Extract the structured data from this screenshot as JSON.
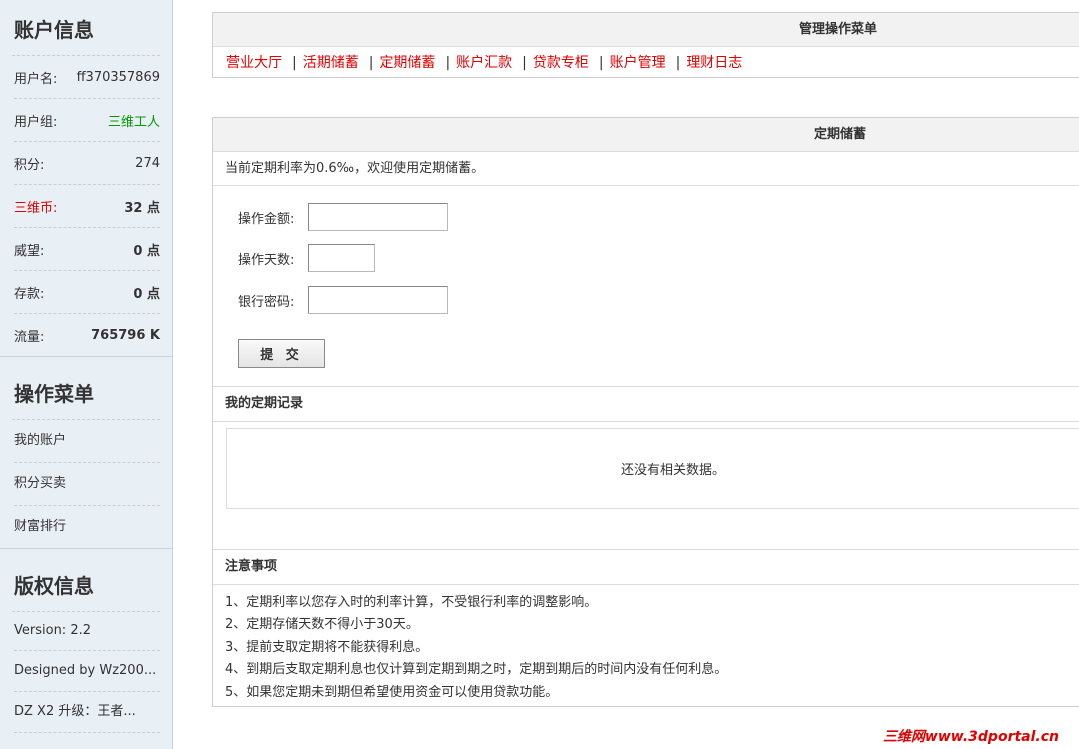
{
  "sidebar": {
    "account_title": "账户信息",
    "account_rows": [
      {
        "key": "用户名:",
        "value": "ff370357869"
      },
      {
        "key": "用户组:",
        "value": "三维工人"
      },
      {
        "key": "积分:",
        "value": "274"
      },
      {
        "key": "三维币:",
        "value": "32 点"
      },
      {
        "key": "威望:",
        "value": "0 点"
      },
      {
        "key": "存款:",
        "value": "0 点"
      },
      {
        "key": "流量:",
        "value": "765796 K"
      }
    ],
    "menu_title": "操作菜单",
    "menu_items": [
      "我的账户",
      "积分买卖",
      "财富排行"
    ],
    "copyright_title": "版权信息",
    "copyright_items": [
      "Version: 2.2",
      "Designed by Wz200...",
      "DZ X2 升级：王者..."
    ]
  },
  "top_panel": {
    "title": "管理操作菜单",
    "links": [
      "营业大厅",
      "活期储蓄",
      "定期储蓄",
      "账户汇款",
      "贷款专柜",
      "账户管理",
      "理财日志"
    ],
    "separator": "|"
  },
  "deposit_panel": {
    "title": "定期储蓄",
    "rate_text": "当前定期利率为0.6‰，欢迎使用定期储蓄。",
    "amount_label": "操作金额:",
    "amount_value": "",
    "days_label": "操作天数:",
    "days_value": "",
    "password_label": "银行密码:",
    "password_value": "",
    "submit_label": "提 交",
    "records_title": "我的定期记录",
    "records_empty": "还没有相关数据。",
    "notes_title": "注意事项",
    "notes": [
      "1、定期利率以您存入时的利率计算，不受银行利率的调整影响。",
      "2、定期存储天数不得小于30天。",
      "3、提前支取定期将不能获得利息。",
      "4、到期后支取定期利息也仅计算到定期到期之时，定期到期后的时间内没有任何利息。",
      "5、如果您定期未到期但希望使用资金可以使用贷款功能。"
    ]
  },
  "watermark": "三维网www.3dportal.cn",
  "colors": {
    "accent_red": "#e00000",
    "sidebar_bg": "#e8eff5",
    "green": "#009900"
  }
}
